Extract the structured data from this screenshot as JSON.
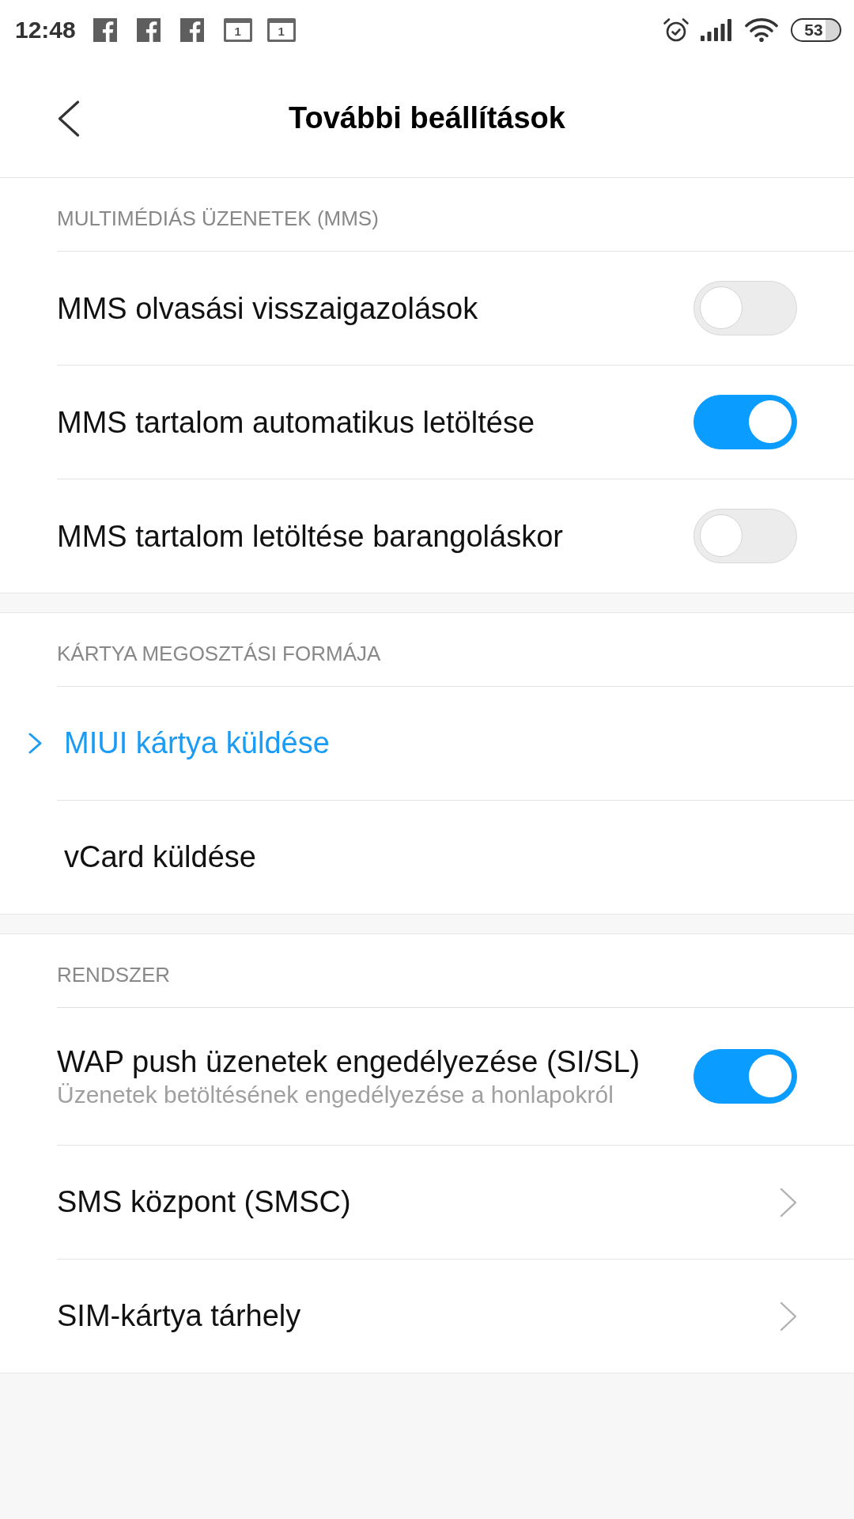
{
  "status_bar": {
    "time": "12:48",
    "notifications": [
      {
        "kind": "facebook"
      },
      {
        "kind": "facebook"
      },
      {
        "kind": "facebook"
      },
      {
        "kind": "calendar",
        "text": "1"
      },
      {
        "kind": "calendar",
        "text": "1"
      }
    ],
    "battery": "53"
  },
  "header": {
    "title": "További beállítások"
  },
  "sections": [
    {
      "title": "MULTIMÉDIÁS ÜZENETEK (MMS)",
      "items": [
        {
          "kind": "toggle",
          "label": "MMS olvasási visszaigazolások",
          "on": false
        },
        {
          "kind": "toggle",
          "label": "MMS tartalom automatikus letöltése",
          "on": true
        },
        {
          "kind": "toggle",
          "label": "MMS tartalom letöltése barangoláskor",
          "on": false
        }
      ]
    },
    {
      "title": "KÁRTYA MEGOSZTÁSI FORMÁJA",
      "items": [
        {
          "kind": "choice",
          "label": "MIUI kártya küldése",
          "selected": true
        },
        {
          "kind": "choice",
          "label": "vCard küldése",
          "selected": false
        }
      ]
    },
    {
      "title": "RENDSZER",
      "items": [
        {
          "kind": "toggle",
          "label": "WAP push üzenetek engedélyezése (SI/SL)",
          "subtitle": "Üzenetek betöltésének engedélyezése a honlapokról",
          "on": true
        },
        {
          "kind": "link",
          "label": "SMS központ (SMSC)"
        },
        {
          "kind": "link",
          "label": "SIM-kártya tárhely"
        }
      ]
    }
  ]
}
